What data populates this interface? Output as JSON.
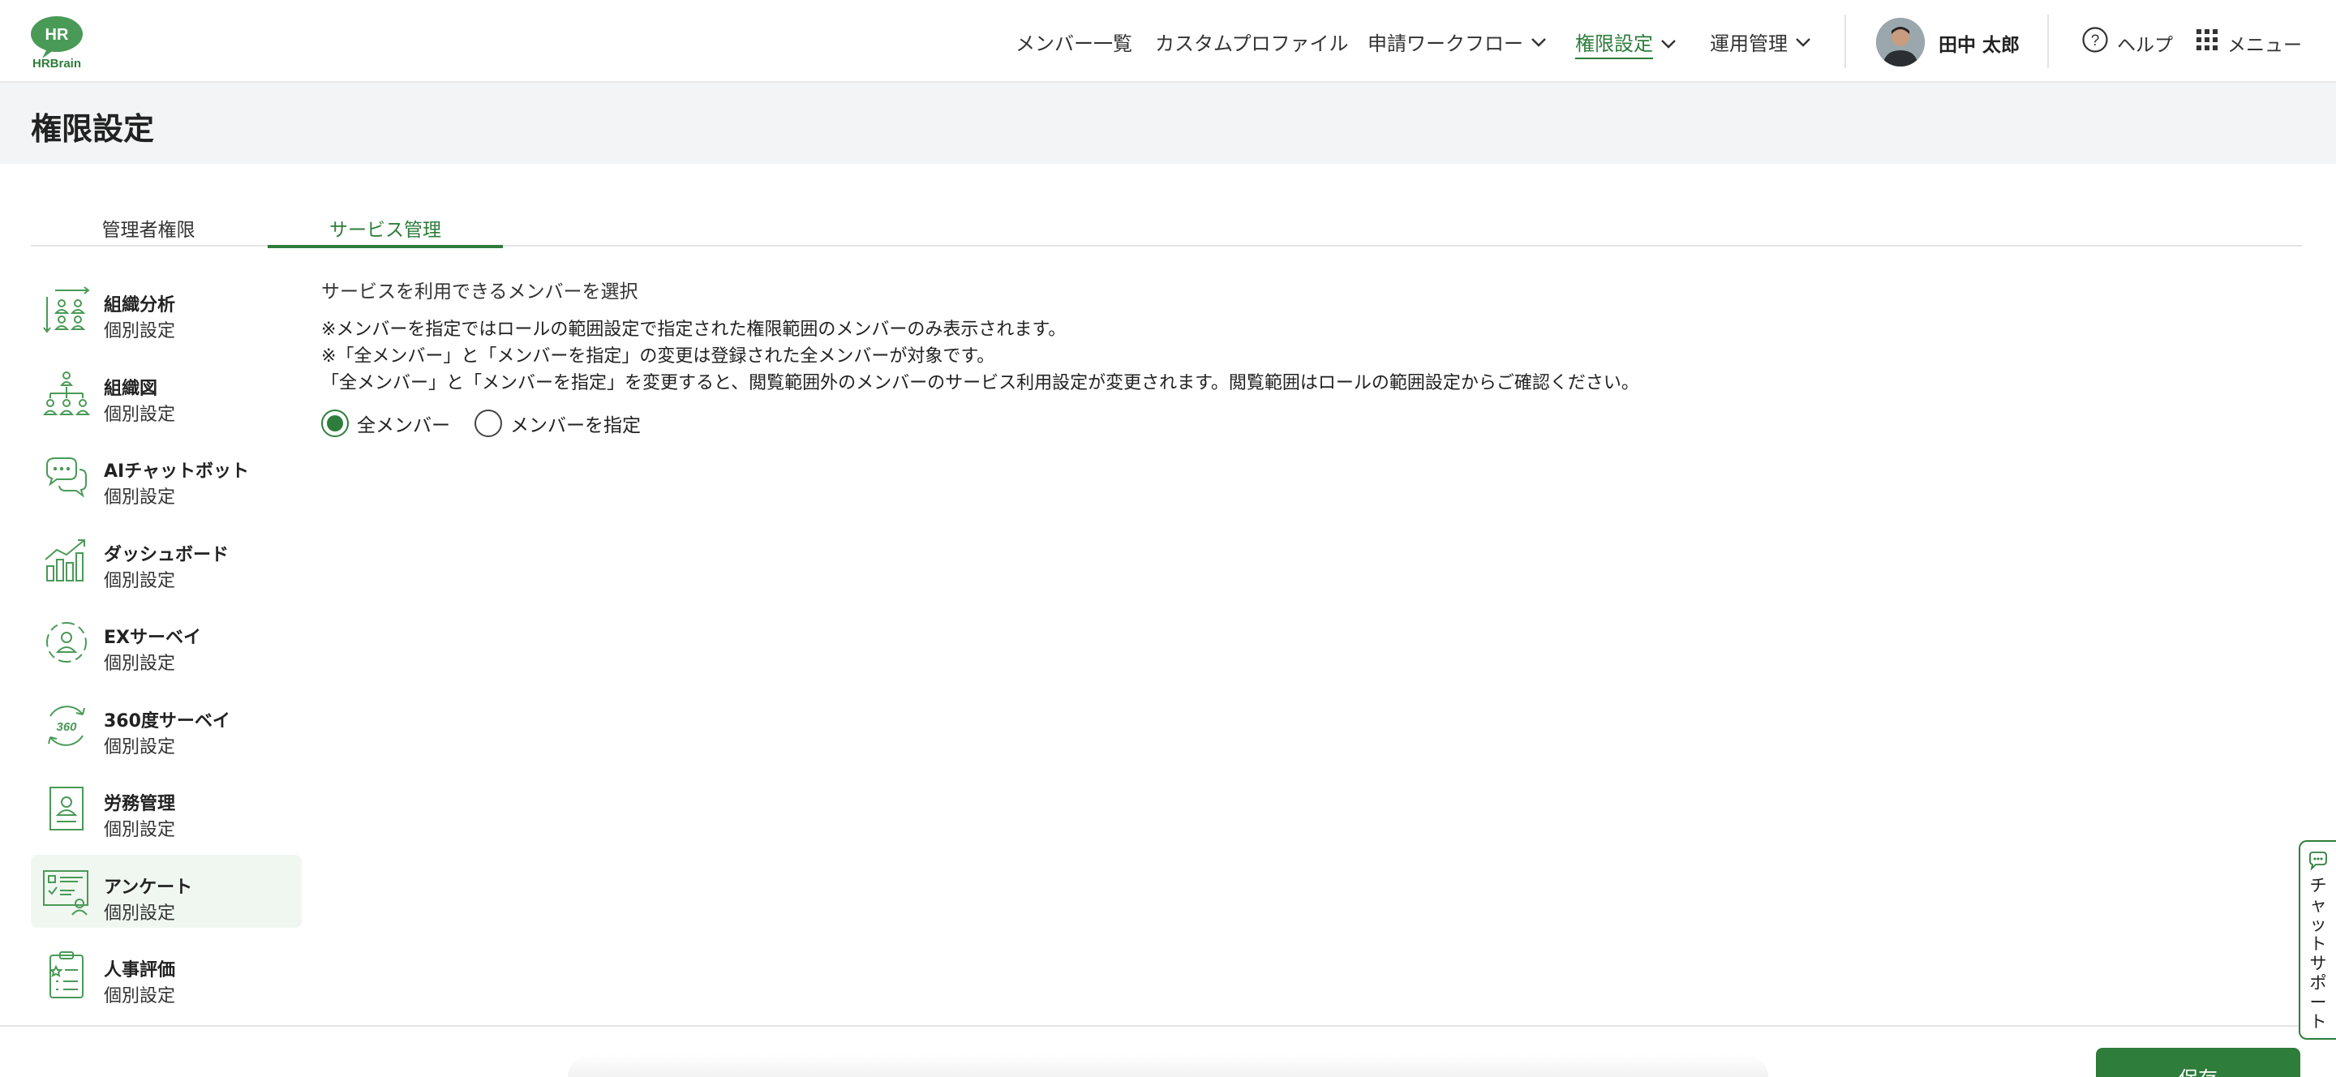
{
  "header": {
    "logo_text_top": "HR",
    "logo_text_bottom": "HRBrain",
    "nav": {
      "members": "メンバー一覧",
      "custom_profile": "カスタムプロファイル",
      "workflow": "申請ワークフロー",
      "permissions": "権限設定",
      "operations": "運用管理"
    },
    "user_name": "田中 太郎",
    "help": "ヘルプ",
    "menu": "メニュー"
  },
  "page": {
    "title": "権限設定"
  },
  "tabs": {
    "admin": "管理者権限",
    "service": "サービス管理"
  },
  "sidebar": {
    "items": [
      {
        "name": "組織分析",
        "sub": "個別設定",
        "icon": "org-analysis-icon"
      },
      {
        "name": "組織図",
        "sub": "個別設定",
        "icon": "org-chart-icon"
      },
      {
        "name": "AIチャットボット",
        "sub": "個別設定",
        "icon": "chatbot-icon"
      },
      {
        "name": "ダッシュボード",
        "sub": "個別設定",
        "icon": "dashboard-icon"
      },
      {
        "name": "EXサーベイ",
        "sub": "個別設定",
        "icon": "ex-survey-icon"
      },
      {
        "name": "360度サーベイ",
        "sub": "個別設定",
        "icon": "survey-360-icon"
      },
      {
        "name": "労務管理",
        "sub": "個別設定",
        "icon": "labor-management-icon"
      },
      {
        "name": "アンケート",
        "sub": "個別設定",
        "icon": "questionnaire-icon"
      },
      {
        "name": "人事評価",
        "sub": "個別設定",
        "icon": "hr-evaluation-icon"
      }
    ],
    "active_index": 7
  },
  "main": {
    "heading": "サービスを利用できるメンバーを選択",
    "notes": [
      "※メンバーを指定ではロールの範囲設定で指定された権限範囲のメンバーのみ表示されます。",
      "※「全メンバー」と「メンバーを指定」の変更は登録された全メンバーが対象です。",
      "「全メンバー」と「メンバーを指定」を変更すると、閲覧範囲外のメンバーのサービス利用設定が変更されます。閲覧範囲はロールの範囲設定からご確認ください。"
    ],
    "radio_all": "全メンバー",
    "radio_specify": "メンバーを指定",
    "selected": "all"
  },
  "footer": {
    "save": "保存"
  },
  "chat_support": {
    "label": "チャットサポート"
  },
  "colors": {
    "accent": "#2e7d3b",
    "icon_green": "#4a9a57",
    "title_band": "#f3f4f5",
    "active_item_bg": "#f0f7f1"
  }
}
